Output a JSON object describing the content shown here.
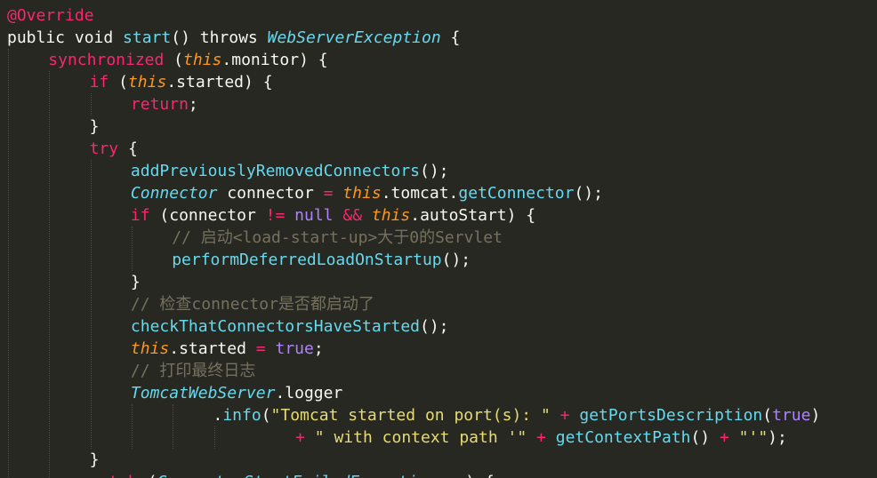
{
  "editor": {
    "theme": {
      "background": "#272822",
      "text": "#F8F8F2",
      "keyword": "#F92672",
      "function": "#66D9EF",
      "this": "#FD971F",
      "constant": "#AE81FF",
      "string": "#E6DB74",
      "comment": "#75715E"
    },
    "lines": [
      {
        "indent": 0,
        "tokens": [
          {
            "t": "@Override",
            "c": "ann"
          }
        ]
      },
      {
        "indent": 0,
        "tokens": [
          {
            "t": "public void ",
            "c": "kw-plain"
          },
          {
            "t": "start",
            "c": "fn"
          },
          {
            "t": "() throws ",
            "c": "txt"
          },
          {
            "t": "WebServerException",
            "c": "type"
          },
          {
            "t": " {",
            "c": "txt"
          }
        ]
      },
      {
        "indent": 1,
        "tokens": [
          {
            "t": "synchronized",
            "c": "kw"
          },
          {
            "t": " (",
            "c": "txt"
          },
          {
            "t": "this",
            "c": "this"
          },
          {
            "t": ".monitor) {",
            "c": "txt"
          }
        ]
      },
      {
        "indent": 2,
        "tokens": [
          {
            "t": "if",
            "c": "kw"
          },
          {
            "t": " (",
            "c": "txt"
          },
          {
            "t": "this",
            "c": "this"
          },
          {
            "t": ".started) {",
            "c": "txt"
          }
        ]
      },
      {
        "indent": 3,
        "tokens": [
          {
            "t": "return",
            "c": "kw"
          },
          {
            "t": ";",
            "c": "txt"
          }
        ]
      },
      {
        "indent": 2,
        "tokens": [
          {
            "t": "}",
            "c": "txt"
          }
        ]
      },
      {
        "indent": 2,
        "tokens": [
          {
            "t": "try",
            "c": "kw"
          },
          {
            "t": " {",
            "c": "txt"
          }
        ]
      },
      {
        "indent": 3,
        "tokens": [
          {
            "t": "addPreviouslyRemovedConnectors",
            "c": "fn"
          },
          {
            "t": "();",
            "c": "txt"
          }
        ]
      },
      {
        "indent": 3,
        "tokens": [
          {
            "t": "Connector",
            "c": "type"
          },
          {
            "t": " connector ",
            "c": "txt"
          },
          {
            "t": "=",
            "c": "op"
          },
          {
            "t": " ",
            "c": "txt"
          },
          {
            "t": "this",
            "c": "this"
          },
          {
            "t": ".tomcat.",
            "c": "txt"
          },
          {
            "t": "getConnector",
            "c": "fn"
          },
          {
            "t": "();",
            "c": "txt"
          }
        ]
      },
      {
        "indent": 3,
        "tokens": [
          {
            "t": "if",
            "c": "kw"
          },
          {
            "t": " (connector ",
            "c": "txt"
          },
          {
            "t": "!=",
            "c": "op"
          },
          {
            "t": " ",
            "c": "txt"
          },
          {
            "t": "null",
            "c": "const"
          },
          {
            "t": " ",
            "c": "txt"
          },
          {
            "t": "&&",
            "c": "op"
          },
          {
            "t": " ",
            "c": "txt"
          },
          {
            "t": "this",
            "c": "this"
          },
          {
            "t": ".autoStart) {",
            "c": "txt"
          }
        ]
      },
      {
        "indent": 4,
        "tokens": [
          {
            "t": "// 启动<load-start-up>大于0的Servlet",
            "c": "cmt"
          }
        ]
      },
      {
        "indent": 4,
        "tokens": [
          {
            "t": "performDeferredLoadOnStartup",
            "c": "fn"
          },
          {
            "t": "();",
            "c": "txt"
          }
        ]
      },
      {
        "indent": 3,
        "tokens": [
          {
            "t": "}",
            "c": "txt"
          }
        ]
      },
      {
        "indent": 3,
        "tokens": [
          {
            "t": "// 检查connector是否都启动了",
            "c": "cmt"
          }
        ]
      },
      {
        "indent": 3,
        "tokens": [
          {
            "t": "checkThatConnectorsHaveStarted",
            "c": "fn"
          },
          {
            "t": "();",
            "c": "txt"
          }
        ]
      },
      {
        "indent": 3,
        "tokens": [
          {
            "t": "this",
            "c": "this"
          },
          {
            "t": ".started ",
            "c": "txt"
          },
          {
            "t": "=",
            "c": "op"
          },
          {
            "t": " ",
            "c": "txt"
          },
          {
            "t": "true",
            "c": "const"
          },
          {
            "t": ";",
            "c": "txt"
          }
        ]
      },
      {
        "indent": 3,
        "tokens": [
          {
            "t": "// 打印最终日志",
            "c": "cmt"
          }
        ]
      },
      {
        "indent": 3,
        "tokens": [
          {
            "t": "TomcatWebServer",
            "c": "type"
          },
          {
            "t": ".logger",
            "c": "txt"
          }
        ]
      },
      {
        "indent": 5,
        "tokens": [
          {
            "t": ".",
            "c": "txt"
          },
          {
            "t": "info",
            "c": "fn"
          },
          {
            "t": "(",
            "c": "txt"
          },
          {
            "t": "\"Tomcat started on port(s): \"",
            "c": "str"
          },
          {
            "t": " ",
            "c": "txt"
          },
          {
            "t": "+",
            "c": "op"
          },
          {
            "t": " ",
            "c": "txt"
          },
          {
            "t": "getPortsDescription",
            "c": "fn"
          },
          {
            "t": "(",
            "c": "txt"
          },
          {
            "t": "true",
            "c": "const"
          },
          {
            "t": ")",
            "c": "txt"
          }
        ]
      },
      {
        "indent": 7,
        "tokens": [
          {
            "t": "+",
            "c": "op"
          },
          {
            "t": " ",
            "c": "txt"
          },
          {
            "t": "\" with context path '\"",
            "c": "str"
          },
          {
            "t": " ",
            "c": "txt"
          },
          {
            "t": "+",
            "c": "op"
          },
          {
            "t": " ",
            "c": "txt"
          },
          {
            "t": "getContextPath",
            "c": "fn"
          },
          {
            "t": "() ",
            "c": "txt"
          },
          {
            "t": "+",
            "c": "op"
          },
          {
            "t": " ",
            "c": "txt"
          },
          {
            "t": "\"'\"",
            "c": "str"
          },
          {
            "t": ");",
            "c": "txt"
          }
        ]
      },
      {
        "indent": 2,
        "tokens": [
          {
            "t": "}",
            "c": "txt"
          }
        ]
      },
      {
        "indent": 2,
        "tokens": [
          {
            "t": "catch",
            "c": "kw"
          },
          {
            "t": " (",
            "c": "txt"
          },
          {
            "t": "ConnectorStartFailedException",
            "c": "type"
          },
          {
            "t": " ex) {",
            "c": "txt"
          }
        ]
      }
    ]
  }
}
